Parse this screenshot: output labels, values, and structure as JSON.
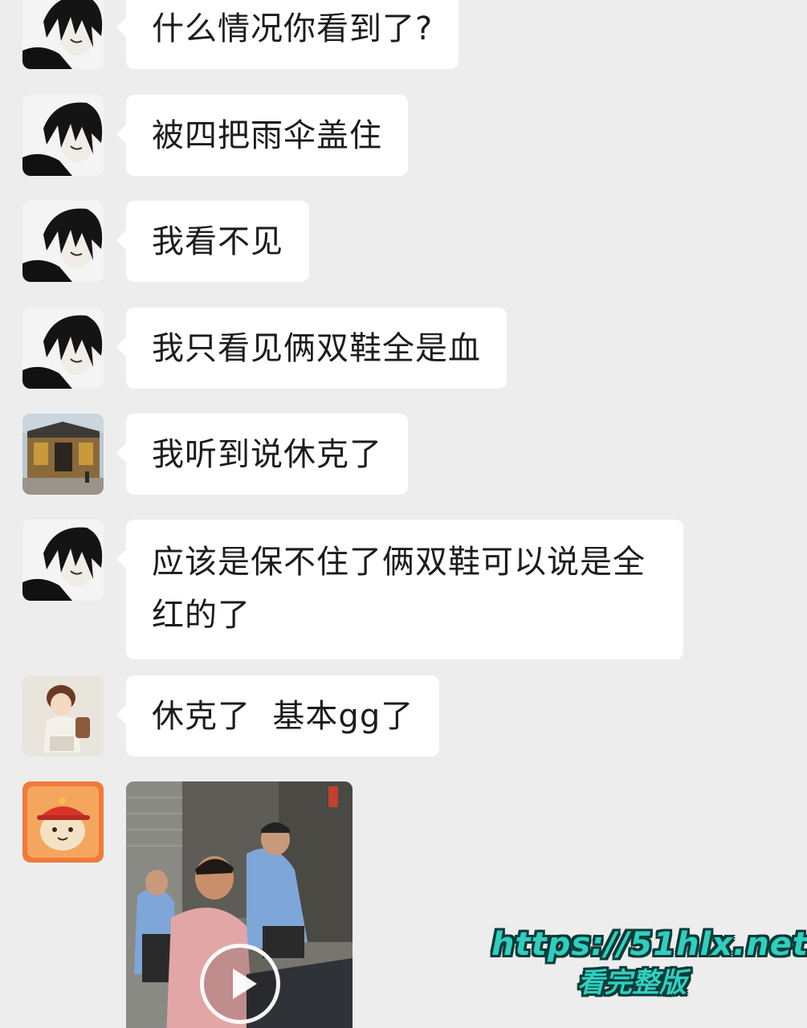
{
  "messages": [
    {
      "avatar": "dark-hair-anime-avatar",
      "text": "什么情况你看到了?"
    },
    {
      "avatar": "dark-hair-anime-avatar",
      "text": "被四把雨伞盖住"
    },
    {
      "avatar": "dark-hair-anime-avatar",
      "text": "我看不见"
    },
    {
      "avatar": "dark-hair-anime-avatar",
      "text": "我只看见俩双鞋全是血"
    },
    {
      "avatar": "temple-building-photo-avatar",
      "text": "我听到说休克了"
    },
    {
      "avatar": "dark-hair-anime-avatar",
      "line1": "应该是保不住了俩双鞋可以说是全",
      "line2": "红的了"
    },
    {
      "avatar": "cartoon-boy-with-backpack-avatar",
      "text": "休克了  基本gg了"
    },
    {
      "avatar": "red-hat-puppy-sticker-avatar",
      "video": {
        "icon": "play-icon"
      }
    }
  ],
  "watermark": {
    "url": "https://51hlx.net",
    "cta": "看完整版"
  },
  "colors": {
    "background": "#ededed",
    "bubble": "#ffffff",
    "text": "#1c1c1c",
    "watermark": "#2fcfc0"
  }
}
